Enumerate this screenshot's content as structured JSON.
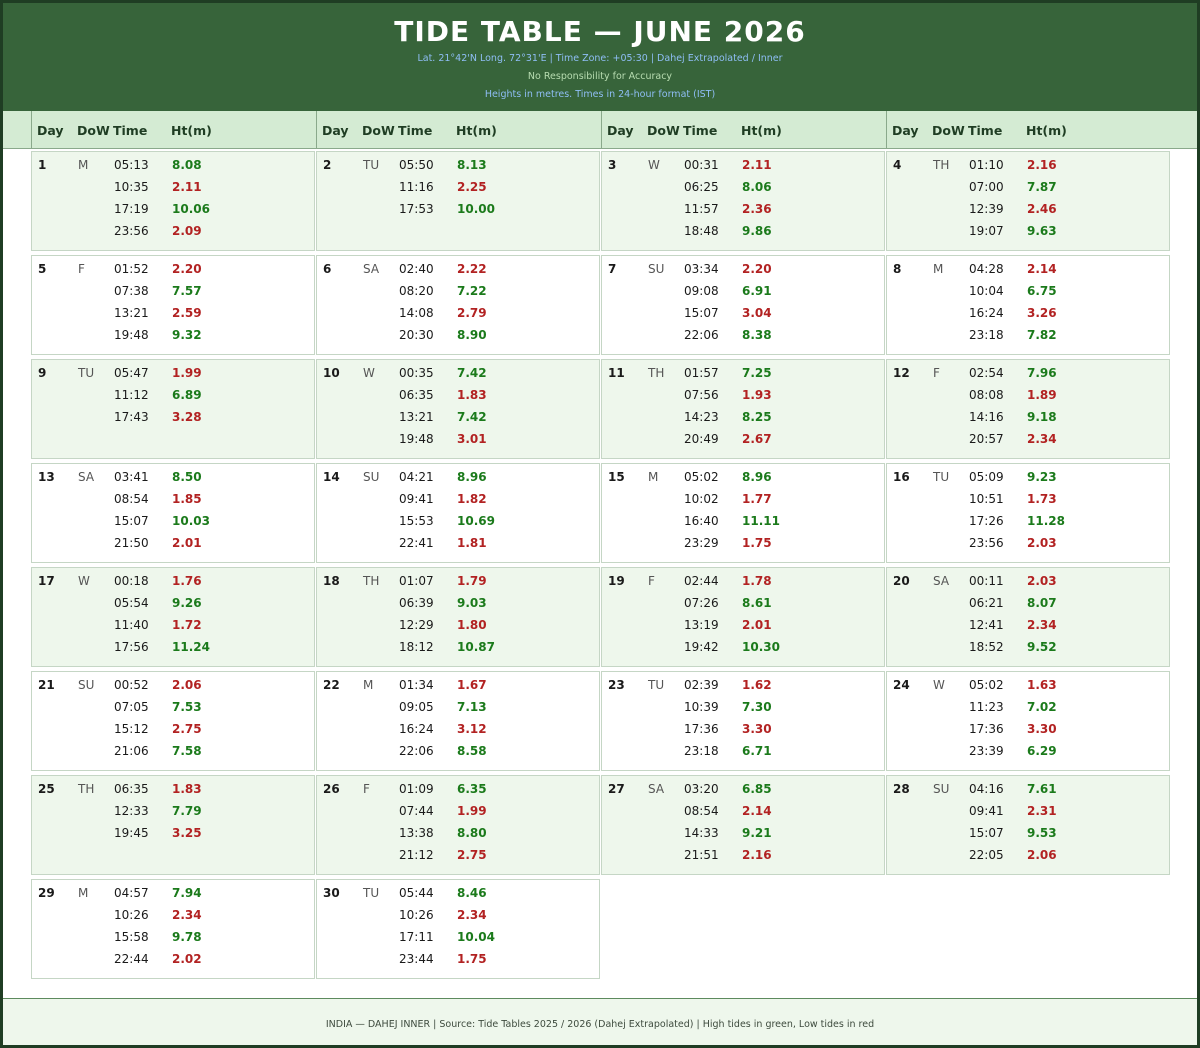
{
  "title": "TIDE TABLE — JUNE 2026",
  "subtitle_location": "Lat. 21°42'N  Long. 72°31'E   |   Time Zone: +05:30   |   Dahej Extrapolated / Inner",
  "subtitle_disclaimer": "No Responsibility for Accuracy",
  "subtitle_units": "Heights in metres.  Times in 24-hour format (IST)",
  "column_headers": {
    "day": "Day",
    "dow": "DoW",
    "time": "Time",
    "height": "Ht(m)"
  },
  "footer": "INDIA — DAHEJ INNER   |   Source: Tide Tables 2025 / 2026 (Dahej Extrapolated)   |   High tides in green, Low tides in red",
  "colors": {
    "header_bg": "#37643a",
    "high": "#1b7a1b",
    "low": "#b22222",
    "shade": "#eef7ec"
  },
  "days": [
    {
      "day": "1",
      "dow": "M",
      "tides": [
        {
          "time": "05:13",
          "ht": "8.08",
          "type": "high"
        },
        {
          "time": "10:35",
          "ht": "2.11",
          "type": "low"
        },
        {
          "time": "17:19",
          "ht": "10.06",
          "type": "high"
        },
        {
          "time": "23:56",
          "ht": "2.09",
          "type": "low"
        }
      ]
    },
    {
      "day": "2",
      "dow": "TU",
      "tides": [
        {
          "time": "05:50",
          "ht": "8.13",
          "type": "high"
        },
        {
          "time": "11:16",
          "ht": "2.25",
          "type": "low"
        },
        {
          "time": "17:53",
          "ht": "10.00",
          "type": "high"
        }
      ]
    },
    {
      "day": "3",
      "dow": "W",
      "tides": [
        {
          "time": "00:31",
          "ht": "2.11",
          "type": "low"
        },
        {
          "time": "06:25",
          "ht": "8.06",
          "type": "high"
        },
        {
          "time": "11:57",
          "ht": "2.36",
          "type": "low"
        },
        {
          "time": "18:48",
          "ht": "9.86",
          "type": "high"
        }
      ]
    },
    {
      "day": "4",
      "dow": "TH",
      "tides": [
        {
          "time": "01:10",
          "ht": "2.16",
          "type": "low"
        },
        {
          "time": "07:00",
          "ht": "7.87",
          "type": "high"
        },
        {
          "time": "12:39",
          "ht": "2.46",
          "type": "low"
        },
        {
          "time": "19:07",
          "ht": "9.63",
          "type": "high"
        }
      ]
    },
    {
      "day": "5",
      "dow": "F",
      "tides": [
        {
          "time": "01:52",
          "ht": "2.20",
          "type": "low"
        },
        {
          "time": "07:38",
          "ht": "7.57",
          "type": "high"
        },
        {
          "time": "13:21",
          "ht": "2.59",
          "type": "low"
        },
        {
          "time": "19:48",
          "ht": "9.32",
          "type": "high"
        }
      ]
    },
    {
      "day": "6",
      "dow": "SA",
      "tides": [
        {
          "time": "02:40",
          "ht": "2.22",
          "type": "low"
        },
        {
          "time": "08:20",
          "ht": "7.22",
          "type": "high"
        },
        {
          "time": "14:08",
          "ht": "2.79",
          "type": "low"
        },
        {
          "time": "20:30",
          "ht": "8.90",
          "type": "high"
        }
      ]
    },
    {
      "day": "7",
      "dow": "SU",
      "tides": [
        {
          "time": "03:34",
          "ht": "2.20",
          "type": "low"
        },
        {
          "time": "09:08",
          "ht": "6.91",
          "type": "high"
        },
        {
          "time": "15:07",
          "ht": "3.04",
          "type": "low"
        },
        {
          "time": "22:06",
          "ht": "8.38",
          "type": "high"
        }
      ]
    },
    {
      "day": "8",
      "dow": "M",
      "tides": [
        {
          "time": "04:28",
          "ht": "2.14",
          "type": "low"
        },
        {
          "time": "10:04",
          "ht": "6.75",
          "type": "high"
        },
        {
          "time": "16:24",
          "ht": "3.26",
          "type": "low"
        },
        {
          "time": "23:18",
          "ht": "7.82",
          "type": "high"
        }
      ]
    },
    {
      "day": "9",
      "dow": "TU",
      "tides": [
        {
          "time": "05:47",
          "ht": "1.99",
          "type": "low"
        },
        {
          "time": "11:12",
          "ht": "6.89",
          "type": "high"
        },
        {
          "time": "17:43",
          "ht": "3.28",
          "type": "low"
        }
      ]
    },
    {
      "day": "10",
      "dow": "W",
      "tides": [
        {
          "time": "00:35",
          "ht": "7.42",
          "type": "high"
        },
        {
          "time": "06:35",
          "ht": "1.83",
          "type": "low"
        },
        {
          "time": "13:21",
          "ht": "7.42",
          "type": "high"
        },
        {
          "time": "19:48",
          "ht": "3.01",
          "type": "low"
        }
      ]
    },
    {
      "day": "11",
      "dow": "TH",
      "tides": [
        {
          "time": "01:57",
          "ht": "7.25",
          "type": "high"
        },
        {
          "time": "07:56",
          "ht": "1.93",
          "type": "low"
        },
        {
          "time": "14:23",
          "ht": "8.25",
          "type": "high"
        },
        {
          "time": "20:49",
          "ht": "2.67",
          "type": "low"
        }
      ]
    },
    {
      "day": "12",
      "dow": "F",
      "tides": [
        {
          "time": "02:54",
          "ht": "7.96",
          "type": "high"
        },
        {
          "time": "08:08",
          "ht": "1.89",
          "type": "low"
        },
        {
          "time": "14:16",
          "ht": "9.18",
          "type": "high"
        },
        {
          "time": "20:57",
          "ht": "2.34",
          "type": "low"
        }
      ]
    },
    {
      "day": "13",
      "dow": "SA",
      "tides": [
        {
          "time": "03:41",
          "ht": "8.50",
          "type": "high"
        },
        {
          "time": "08:54",
          "ht": "1.85",
          "type": "low"
        },
        {
          "time": "15:07",
          "ht": "10.03",
          "type": "high"
        },
        {
          "time": "21:50",
          "ht": "2.01",
          "type": "low"
        }
      ]
    },
    {
      "day": "14",
      "dow": "SU",
      "tides": [
        {
          "time": "04:21",
          "ht": "8.96",
          "type": "high"
        },
        {
          "time": "09:41",
          "ht": "1.82",
          "type": "low"
        },
        {
          "time": "15:53",
          "ht": "10.69",
          "type": "high"
        },
        {
          "time": "22:41",
          "ht": "1.81",
          "type": "low"
        }
      ]
    },
    {
      "day": "15",
      "dow": "M",
      "tides": [
        {
          "time": "05:02",
          "ht": "8.96",
          "type": "high"
        },
        {
          "time": "10:02",
          "ht": "1.77",
          "type": "low"
        },
        {
          "time": "16:40",
          "ht": "11.11",
          "type": "high"
        },
        {
          "time": "23:29",
          "ht": "1.75",
          "type": "low"
        }
      ]
    },
    {
      "day": "16",
      "dow": "TU",
      "tides": [
        {
          "time": "05:09",
          "ht": "9.23",
          "type": "high"
        },
        {
          "time": "10:51",
          "ht": "1.73",
          "type": "low"
        },
        {
          "time": "17:26",
          "ht": "11.28",
          "type": "high"
        },
        {
          "time": "23:56",
          "ht": "2.03",
          "type": "low"
        }
      ]
    },
    {
      "day": "17",
      "dow": "W",
      "tides": [
        {
          "time": "00:18",
          "ht": "1.76",
          "type": "low"
        },
        {
          "time": "05:54",
          "ht": "9.26",
          "type": "high"
        },
        {
          "time": "11:40",
          "ht": "1.72",
          "type": "low"
        },
        {
          "time": "17:56",
          "ht": "11.24",
          "type": "high"
        }
      ]
    },
    {
      "day": "18",
      "dow": "TH",
      "tides": [
        {
          "time": "01:07",
          "ht": "1.79",
          "type": "low"
        },
        {
          "time": "06:39",
          "ht": "9.03",
          "type": "high"
        },
        {
          "time": "12:29",
          "ht": "1.80",
          "type": "low"
        },
        {
          "time": "18:12",
          "ht": "10.87",
          "type": "high"
        }
      ]
    },
    {
      "day": "19",
      "dow": "F",
      "tides": [
        {
          "time": "02:44",
          "ht": "1.78",
          "type": "low"
        },
        {
          "time": "07:26",
          "ht": "8.61",
          "type": "high"
        },
        {
          "time": "13:19",
          "ht": "2.01",
          "type": "low"
        },
        {
          "time": "19:42",
          "ht": "10.30",
          "type": "high"
        }
      ]
    },
    {
      "day": "20",
      "dow": "SA",
      "tides": [
        {
          "time": "00:11",
          "ht": "2.03",
          "type": "low"
        },
        {
          "time": "06:21",
          "ht": "8.07",
          "type": "high"
        },
        {
          "time": "12:41",
          "ht": "2.34",
          "type": "low"
        },
        {
          "time": "18:52",
          "ht": "9.52",
          "type": "high"
        }
      ]
    },
    {
      "day": "21",
      "dow": "SU",
      "tides": [
        {
          "time": "00:52",
          "ht": "2.06",
          "type": "low"
        },
        {
          "time": "07:05",
          "ht": "7.53",
          "type": "high"
        },
        {
          "time": "15:12",
          "ht": "2.75",
          "type": "low"
        },
        {
          "time": "21:06",
          "ht": "7.58",
          "type": "high"
        }
      ]
    },
    {
      "day": "22",
      "dow": "M",
      "tides": [
        {
          "time": "01:34",
          "ht": "1.67",
          "type": "low"
        },
        {
          "time": "09:05",
          "ht": "7.13",
          "type": "high"
        },
        {
          "time": "16:24",
          "ht": "3.12",
          "type": "low"
        },
        {
          "time": "22:06",
          "ht": "8.58",
          "type": "high"
        }
      ]
    },
    {
      "day": "23",
      "dow": "TU",
      "tides": [
        {
          "time": "02:39",
          "ht": "1.62",
          "type": "low"
        },
        {
          "time": "10:39",
          "ht": "7.30",
          "type": "high"
        },
        {
          "time": "17:36",
          "ht": "3.30",
          "type": "low"
        },
        {
          "time": "23:18",
          "ht": "6.71",
          "type": "high"
        }
      ]
    },
    {
      "day": "24",
      "dow": "W",
      "tides": [
        {
          "time": "05:02",
          "ht": "1.63",
          "type": "low"
        },
        {
          "time": "11:23",
          "ht": "7.02",
          "type": "high"
        },
        {
          "time": "17:36",
          "ht": "3.30",
          "type": "low"
        },
        {
          "time": "23:39",
          "ht": "6.29",
          "type": "high"
        }
      ]
    },
    {
      "day": "25",
      "dow": "TH",
      "tides": [
        {
          "time": "06:35",
          "ht": "1.83",
          "type": "low"
        },
        {
          "time": "12:33",
          "ht": "7.79",
          "type": "high"
        },
        {
          "time": "19:45",
          "ht": "3.25",
          "type": "low"
        }
      ]
    },
    {
      "day": "26",
      "dow": "F",
      "tides": [
        {
          "time": "01:09",
          "ht": "6.35",
          "type": "high"
        },
        {
          "time": "07:44",
          "ht": "1.99",
          "type": "low"
        },
        {
          "time": "13:38",
          "ht": "8.80",
          "type": "high"
        },
        {
          "time": "21:12",
          "ht": "2.75",
          "type": "low"
        }
      ]
    },
    {
      "day": "27",
      "dow": "SA",
      "tides": [
        {
          "time": "03:20",
          "ht": "6.85",
          "type": "high"
        },
        {
          "time": "08:54",
          "ht": "2.14",
          "type": "low"
        },
        {
          "time": "14:33",
          "ht": "9.21",
          "type": "high"
        },
        {
          "time": "21:51",
          "ht": "2.16",
          "type": "low"
        }
      ]
    },
    {
      "day": "28",
      "dow": "SU",
      "tides": [
        {
          "time": "04:16",
          "ht": "7.61",
          "type": "high"
        },
        {
          "time": "09:41",
          "ht": "2.31",
          "type": "low"
        },
        {
          "time": "15:07",
          "ht": "9.53",
          "type": "high"
        },
        {
          "time": "22:05",
          "ht": "2.06",
          "type": "low"
        }
      ]
    },
    {
      "day": "29",
      "dow": "M",
      "tides": [
        {
          "time": "04:57",
          "ht": "7.94",
          "type": "high"
        },
        {
          "time": "10:26",
          "ht": "2.34",
          "type": "low"
        },
        {
          "time": "15:58",
          "ht": "9.78",
          "type": "high"
        },
        {
          "time": "22:44",
          "ht": "2.02",
          "type": "low"
        }
      ]
    },
    {
      "day": "30",
      "dow": "TU",
      "tides": [
        {
          "time": "05:44",
          "ht": "8.46",
          "type": "high"
        },
        {
          "time": "10:26",
          "ht": "2.34",
          "type": "low"
        },
        {
          "time": "17:11",
          "ht": "10.04",
          "type": "high"
        },
        {
          "time": "23:44",
          "ht": "1.75",
          "type": "low"
        }
      ]
    }
  ]
}
